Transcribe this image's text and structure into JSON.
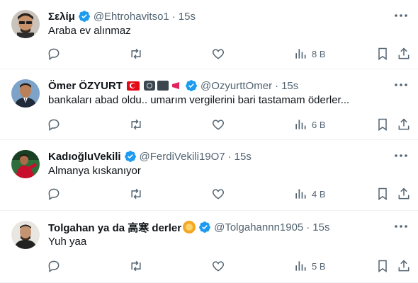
{
  "colors": {
    "verified": "#1d9bf0",
    "secondary_text": "#536471",
    "divider": "#eff3f4"
  },
  "tweets": [
    {
      "name": "Σελίμ",
      "handle": "@Ehtrohavitso1",
      "time": "15s",
      "text": "Araba ev alınmaz",
      "views": "8 B",
      "avatar": "man-sunglasses"
    },
    {
      "name": "Ömer ÖZYURT",
      "handle": "@OzyurttOmer",
      "time": "15s",
      "text": "bankaları abad oldu.. umarım vergilerini bari tastamam öderler...",
      "views": "6 B",
      "avatar": "man-suit",
      "name_icons": [
        "turkey-flag-icon",
        "camera-icon",
        "movie-camera-icon",
        "megaphone-icon"
      ]
    },
    {
      "name": "KadıoğluVekili",
      "handle": "@FerdiVekili19O7",
      "time": "15s",
      "text": "Almanya kıskanıyor",
      "views": "4 B",
      "avatar": "footballer-red-jersey"
    },
    {
      "name": "Tolgahan ya da 高寒 derler",
      "handle": "@Tolgahannn1905",
      "time": "15s",
      "text": "Yuh yaa",
      "views": "5 B",
      "avatar": "man-beard",
      "name_icons": [
        "lion-icon"
      ]
    }
  ]
}
